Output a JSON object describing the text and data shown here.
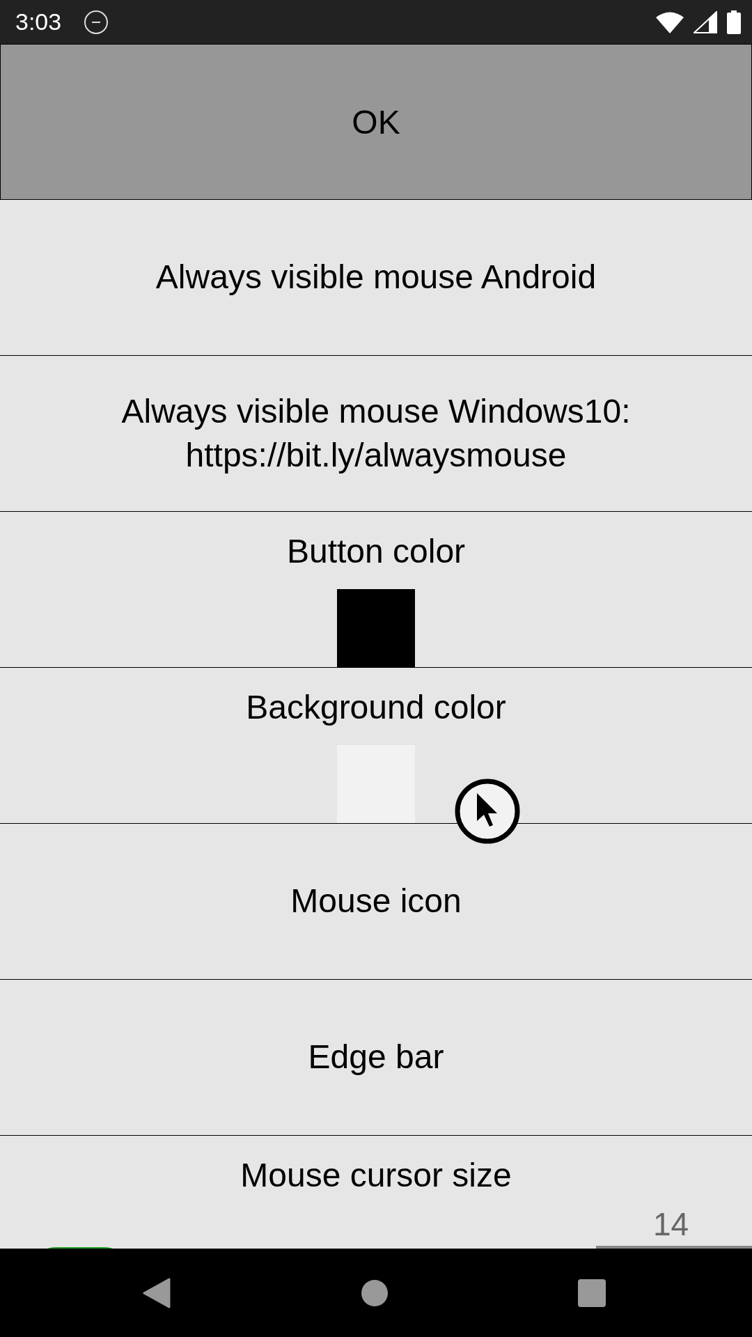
{
  "status_bar": {
    "time": "3:03"
  },
  "ok_button": {
    "label": "OK"
  },
  "settings": [
    {
      "kind": "text",
      "label": "Always visible mouse Android"
    },
    {
      "kind": "text",
      "label": "Always visible mouse Windows10:\nhttps://bit.ly/alwaysmouse"
    },
    {
      "kind": "color",
      "label": "Button color",
      "color": "#000000"
    },
    {
      "kind": "color",
      "label": "Background color",
      "color": "#f2f2f2"
    },
    {
      "kind": "text",
      "label": "Mouse icon"
    },
    {
      "kind": "text",
      "label": "Edge bar"
    },
    {
      "kind": "slider",
      "label": "Mouse cursor size",
      "reading": "14"
    }
  ]
}
